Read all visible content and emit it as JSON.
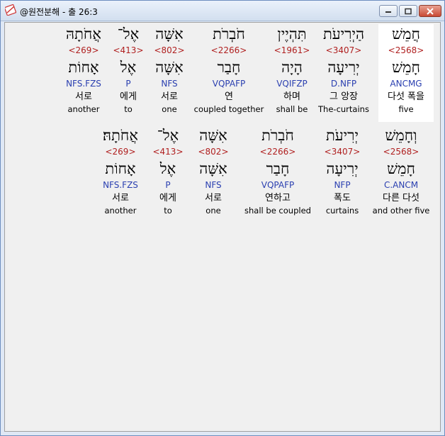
{
  "window": {
    "title": "@원전분해 - 출 26:3",
    "minimize_label": "minimize",
    "maximize_label": "maximize",
    "close_label": "close"
  },
  "rows": [
    {
      "words": [
        {
          "heb": "חֲמֵשׁ",
          "strong": "<2568>",
          "lemma": "חָמֵשׁ",
          "parse": "ANCMG",
          "kor": "다섯 폭을",
          "eng": "five",
          "highlighted": true
        },
        {
          "heb": "הַיְרִיעֹת",
          "strong": "<3407>",
          "lemma": "יְרִיעָה",
          "parse": "D.NFP",
          "kor": "그 앙장",
          "eng": "The-curtains"
        },
        {
          "heb": "תִּהְיֶין",
          "strong": "<1961>",
          "lemma": "הָיָה",
          "parse": "VQIFZP",
          "kor": "하며",
          "eng": "shall be"
        },
        {
          "heb": "חֹבְרֹת",
          "strong": "<2266>",
          "lemma": "חָבַר",
          "parse": "VQPAFP",
          "kor": "연",
          "eng": "coupled together"
        },
        {
          "heb": "אִשָּׁה",
          "strong": "<802>",
          "lemma": "אִשָּׁה",
          "parse": "NFS",
          "kor": "서로",
          "eng": "one"
        },
        {
          "heb": "אֶל־",
          "strong": "<413>",
          "lemma": "אֶל",
          "parse": "P",
          "kor": "에게",
          "eng": "to"
        },
        {
          "heb": "אֲחֹתָהּ",
          "strong": "<269>",
          "lemma": "אָחוֹת",
          "parse": "NFS.FZS",
          "kor": "서로",
          "eng": "another"
        }
      ]
    },
    {
      "words": [
        {
          "heb": "וְחָמֵשׁ",
          "strong": "<2568>",
          "lemma": "חָמֵשׁ",
          "parse": "C.ANCM",
          "kor": "다른 다섯",
          "eng": "and other five"
        },
        {
          "heb": "יְרִיעֹת",
          "strong": "<3407>",
          "lemma": "יְרִיעָה",
          "parse": "NFP",
          "kor": "폭도",
          "eng": "curtains"
        },
        {
          "heb": "חֹבְרֹת",
          "strong": "<2266>",
          "lemma": "חָבַר",
          "parse": "VQPAFP",
          "kor": "연하고",
          "eng": "shall be coupled"
        },
        {
          "heb": "אִשָּׁה",
          "strong": "<802>",
          "lemma": "אִשָּׁה",
          "parse": "NFS",
          "kor": "서로",
          "eng": "one"
        },
        {
          "heb": "אֶל־",
          "strong": "<413>",
          "lemma": "אֶל",
          "parse": "P",
          "kor": "에게",
          "eng": "to"
        },
        {
          "heb": "אֲחֹתָהּ׃",
          "strong": "<269>",
          "lemma": "אָחוֹת",
          "parse": "NFS.FZS",
          "kor": "서로",
          "eng": "another"
        }
      ]
    }
  ]
}
